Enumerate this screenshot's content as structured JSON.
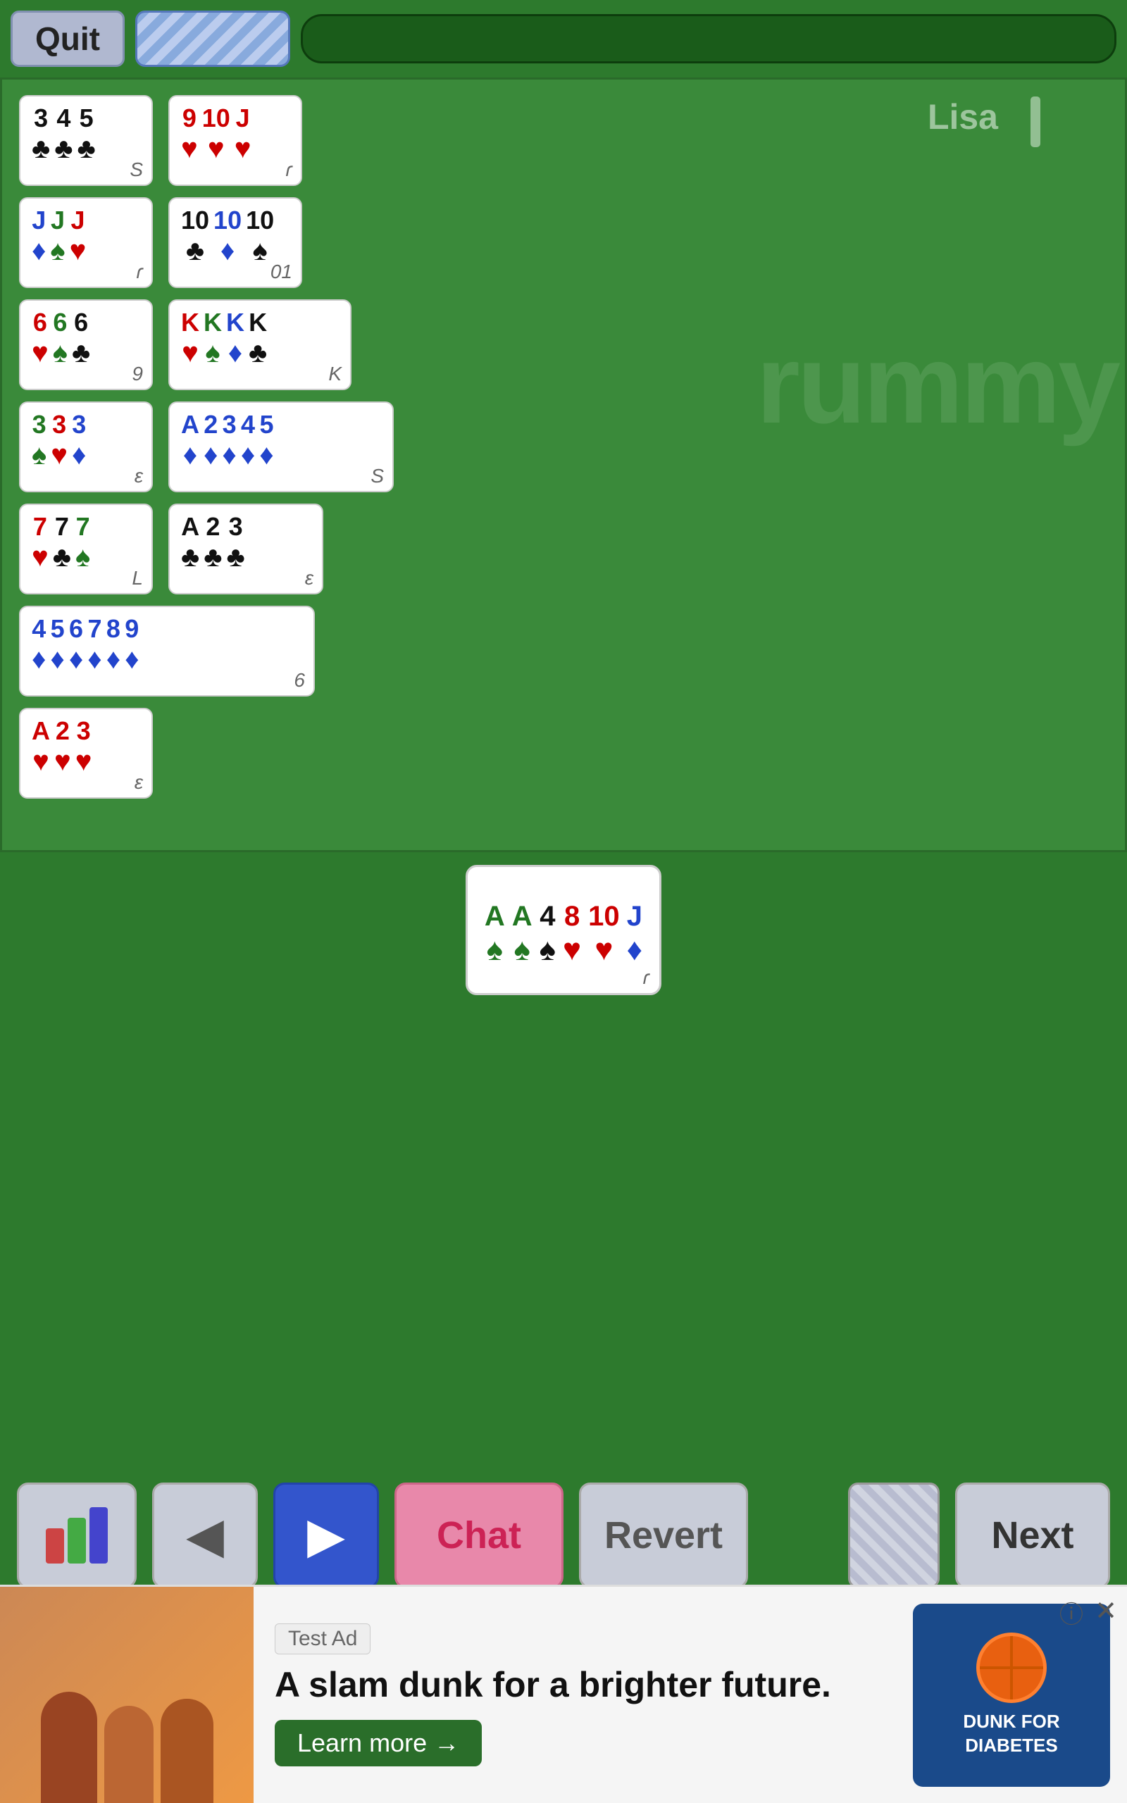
{
  "topBar": {
    "quitLabel": "Quit",
    "playerName": "Lisa"
  },
  "melds": [
    {
      "id": "meld1",
      "cards": [
        {
          "rank": "3",
          "suit": "♣",
          "color": "black"
        },
        {
          "rank": "4",
          "suit": "♣",
          "color": "black"
        },
        {
          "rank": "5",
          "suit": "♣",
          "color": "black"
        }
      ],
      "count": "S"
    },
    {
      "id": "meld2",
      "cards": [
        {
          "rank": "9",
          "suit": "♥",
          "color": "red"
        },
        {
          "rank": "10",
          "suit": "♥",
          "color": "red"
        },
        {
          "rank": "J",
          "suit": "♥",
          "color": "red"
        }
      ],
      "count": "ɾ"
    },
    {
      "id": "meld3",
      "cards": [
        {
          "rank": "J",
          "suit": "♦",
          "color": "blue"
        },
        {
          "rank": "J",
          "suit": "♠",
          "color": "green"
        },
        {
          "rank": "J",
          "suit": "♥",
          "color": "red"
        }
      ],
      "count": "ɾ"
    },
    {
      "id": "meld4",
      "cards": [
        {
          "rank": "10",
          "suit": "♣",
          "color": "black"
        },
        {
          "rank": "10",
          "suit": "♦",
          "color": "blue"
        },
        {
          "rank": "10",
          "suit": "♠",
          "color": "black"
        }
      ],
      "count": "01"
    },
    {
      "id": "meld5",
      "cards": [
        {
          "rank": "6",
          "suit": "♥",
          "color": "red"
        },
        {
          "rank": "6",
          "suit": "♠",
          "color": "green"
        },
        {
          "rank": "6",
          "suit": "♣",
          "color": "black"
        }
      ],
      "count": "9"
    },
    {
      "id": "meld6",
      "cards": [
        {
          "rank": "K",
          "suit": "♥",
          "color": "red"
        },
        {
          "rank": "K",
          "suit": "♠",
          "color": "green"
        },
        {
          "rank": "K",
          "suit": "♦",
          "color": "blue"
        },
        {
          "rank": "K",
          "suit": "♣",
          "color": "black"
        }
      ],
      "count": "K"
    },
    {
      "id": "meld7",
      "cards": [
        {
          "rank": "3",
          "suit": "♠",
          "color": "green"
        },
        {
          "rank": "3",
          "suit": "♥",
          "color": "red"
        },
        {
          "rank": "3",
          "suit": "♦",
          "color": "blue"
        }
      ],
      "count": "ε"
    },
    {
      "id": "meld8",
      "cards": [
        {
          "rank": "A",
          "suit": "♦",
          "color": "blue"
        },
        {
          "rank": "2",
          "suit": "♦",
          "color": "blue"
        },
        {
          "rank": "3",
          "suit": "♦",
          "color": "blue"
        },
        {
          "rank": "4",
          "suit": "♦",
          "color": "blue"
        },
        {
          "rank": "5",
          "suit": "♦",
          "color": "blue"
        }
      ],
      "count": "S"
    },
    {
      "id": "meld9",
      "cards": [
        {
          "rank": "7",
          "suit": "♥",
          "color": "red"
        },
        {
          "rank": "7",
          "suit": "♣",
          "color": "black"
        },
        {
          "rank": "7",
          "suit": "♠",
          "color": "green"
        }
      ],
      "count": "L"
    },
    {
      "id": "meld10",
      "cards": [
        {
          "rank": "A",
          "suit": "♣",
          "color": "black"
        },
        {
          "rank": "2",
          "suit": "♣",
          "color": "black"
        },
        {
          "rank": "3",
          "suit": "♣",
          "color": "black"
        }
      ],
      "count": "ε"
    },
    {
      "id": "meld11",
      "cards": [
        {
          "rank": "4",
          "suit": "♦",
          "color": "blue"
        },
        {
          "rank": "5",
          "suit": "♦",
          "color": "blue"
        },
        {
          "rank": "6",
          "suit": "♦",
          "color": "blue"
        },
        {
          "rank": "7",
          "suit": "♦",
          "color": "blue"
        },
        {
          "rank": "8",
          "suit": "♦",
          "color": "blue"
        },
        {
          "rank": "9",
          "suit": "♦",
          "color": "blue"
        }
      ],
      "count": "6"
    },
    {
      "id": "meld12",
      "cards": [
        {
          "rank": "A",
          "suit": "♥",
          "color": "red"
        },
        {
          "rank": "2",
          "suit": "♥",
          "color": "red"
        },
        {
          "rank": "3",
          "suit": "♥",
          "color": "red"
        }
      ],
      "count": "ε"
    }
  ],
  "playerHand": {
    "cards": [
      {
        "rank": "A",
        "suit": "♠",
        "color": "green"
      },
      {
        "rank": "A",
        "suit": "♠",
        "color": "green"
      },
      {
        "rank": "4",
        "suit": "♠",
        "color": "black"
      },
      {
        "rank": "8",
        "suit": "♥",
        "color": "red"
      },
      {
        "rank": "10",
        "suit": "♥",
        "color": "red"
      },
      {
        "rank": "J",
        "suit": "♦",
        "color": "blue"
      }
    ],
    "count": "ɾ"
  },
  "actions": {
    "sortLabel": "",
    "backLabel": "◀",
    "forwardLabel": "▶",
    "chatLabel": "Chat",
    "revertLabel": "Revert",
    "nextLabel": "Next"
  },
  "ad": {
    "tag": "Test Ad",
    "headline": "A slam dunk for a brighter future.",
    "ctaLabel": "Learn more →",
    "logoText": "DUNK FOR\nDIABETES"
  },
  "watermark": "rummy"
}
